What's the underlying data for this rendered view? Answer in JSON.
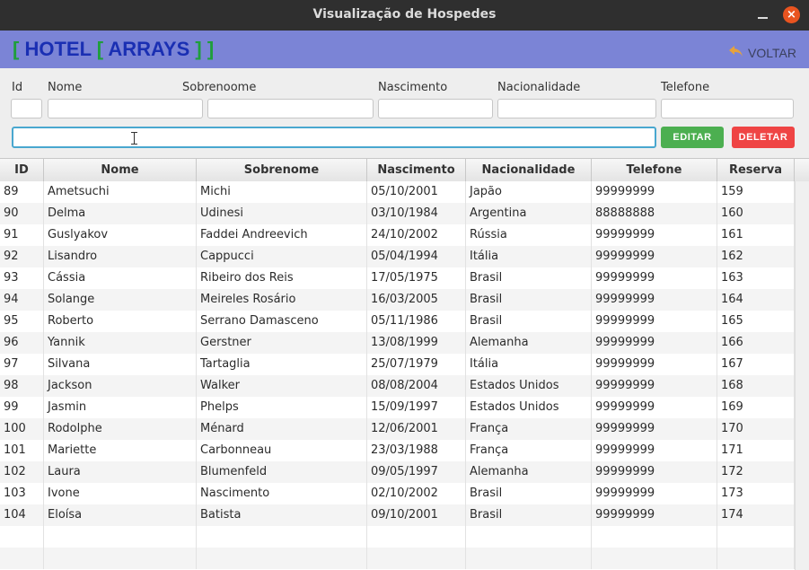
{
  "window": {
    "title": "Visualização de Hospedes",
    "close_glyph": "×"
  },
  "header": {
    "logo": {
      "open1": "[",
      "word1": "HOTEL",
      "open2": "[",
      "word2": "ARRAYS",
      "close": "] ]"
    },
    "back_label": "VOLTAR",
    "back_icon": "undo-arrow-icon",
    "back_icon_color": "#e6a23c"
  },
  "form": {
    "labels": {
      "id": "Id",
      "nome": "Nome",
      "sobrenome": "Sobrenoome",
      "nascimento": "Nascimento",
      "nacionalidade": "Nacionalidade",
      "telefone": "Telefone"
    },
    "values": {
      "id": "",
      "nome": "",
      "sobrenome": "",
      "nascimento": "",
      "nacionalidade": "",
      "telefone": "",
      "search": ""
    },
    "edit_label": "EDITAR",
    "delete_label": "DELETAR"
  },
  "colors": {
    "header_bg": "#7b84d6",
    "logo_bracket": "#1f9e3c",
    "logo_text": "#1a2fb3",
    "edit": "#4caf50",
    "delete": "#ef4444"
  },
  "table": {
    "columns": [
      "ID",
      "Nome",
      "Sobrenome",
      "Nascimento",
      "Nacionalidade",
      "Telefone",
      "Reserva"
    ],
    "rows": [
      [
        "89",
        "Ametsuchi",
        "Michi",
        "05/10/2001",
        "Japão",
        "99999999",
        "159"
      ],
      [
        "90",
        "Delma",
        "Udinesi",
        "03/10/1984",
        "Argentina",
        "88888888",
        "160"
      ],
      [
        "91",
        "Guslyakov",
        "Faddei Andreevich",
        "24/10/2002",
        "Rússia",
        "99999999",
        "161"
      ],
      [
        "92",
        "Lisandro",
        "Cappucci",
        "05/04/1994",
        "Itália",
        "99999999",
        "162"
      ],
      [
        "93",
        "Cássia",
        "Ribeiro dos Reis",
        "17/05/1975",
        "Brasil",
        "99999999",
        "163"
      ],
      [
        "94",
        "Solange",
        "Meireles Rosário",
        "16/03/2005",
        "Brasil",
        "99999999",
        "164"
      ],
      [
        "95",
        "Roberto",
        "Serrano Damasceno",
        "05/11/1986",
        "Brasil",
        "99999999",
        "165"
      ],
      [
        "96",
        "Yannik",
        "Gerstner",
        "13/08/1999",
        "Alemanha",
        "99999999",
        "166"
      ],
      [
        "97",
        "Silvana",
        "Tartaglia",
        "25/07/1979",
        "Itália",
        "99999999",
        "167"
      ],
      [
        "98",
        "Jackson",
        "Walker",
        "08/08/2004",
        "Estados Unidos",
        "99999999",
        "168"
      ],
      [
        "99",
        "Jasmin",
        "Phelps",
        "15/09/1997",
        "Estados Unidos",
        "99999999",
        "169"
      ],
      [
        "100",
        "Rodolphe",
        "Ménard",
        "12/06/2001",
        "França",
        "99999999",
        "170"
      ],
      [
        "101",
        "Mariette",
        "Carbonneau",
        "23/03/1988",
        "França",
        "99999999",
        "171"
      ],
      [
        "102",
        "Laura",
        "Blumenfeld",
        "09/05/1997",
        "Alemanha",
        "99999999",
        "172"
      ],
      [
        "103",
        "Ivone",
        "Nascimento",
        "02/10/2002",
        "Brasil",
        "99999999",
        "173"
      ],
      [
        "104",
        "Eloísa",
        "Batista",
        "09/10/2001",
        "Brasil",
        "99999999",
        "174"
      ],
      [
        "",
        "",
        "",
        "",
        "",
        "",
        ""
      ],
      [
        "",
        "",
        "",
        "",
        "",
        "",
        ""
      ]
    ]
  }
}
